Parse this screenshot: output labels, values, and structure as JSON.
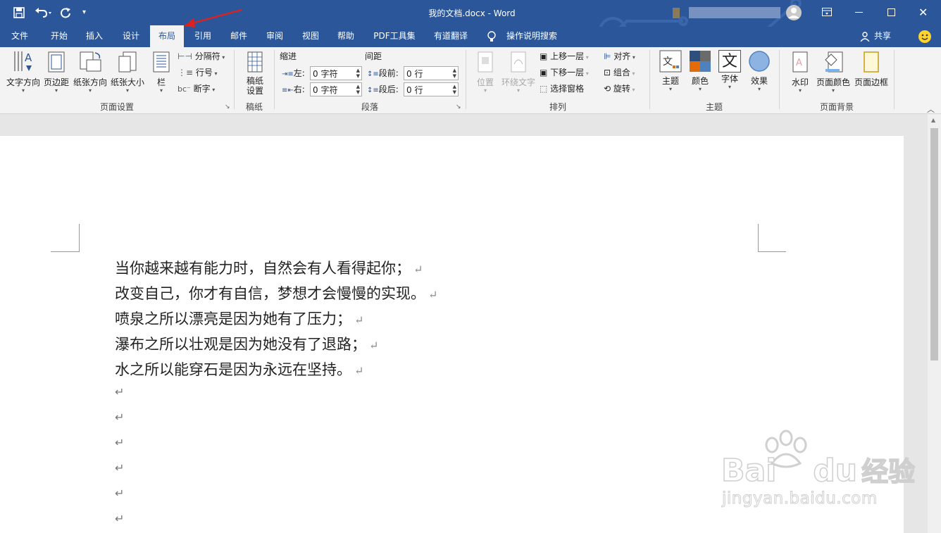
{
  "window": {
    "title": "我的文档.docx - Word",
    "share_label": "共享",
    "quick_access": [
      "save-icon",
      "undo-icon",
      "redo-icon",
      "customize-icon"
    ]
  },
  "tabs": [
    {
      "label": "文件"
    },
    {
      "label": "开始"
    },
    {
      "label": "插入"
    },
    {
      "label": "设计"
    },
    {
      "label": "布局"
    },
    {
      "label": "引用"
    },
    {
      "label": "邮件"
    },
    {
      "label": "审阅"
    },
    {
      "label": "视图"
    },
    {
      "label": "帮助"
    },
    {
      "label": "PDF工具集"
    },
    {
      "label": "有道翻译"
    }
  ],
  "tell_me": "操作说明搜索",
  "ribbon": {
    "page_setup": {
      "label": "页面设置",
      "text_direction": "文字方向",
      "margins": "页边距",
      "orientation": "纸张方向",
      "size": "纸张大小",
      "columns": "栏",
      "breaks": "分隔符",
      "line_numbers": "行号",
      "hyphenation": "断字"
    },
    "manuscript": {
      "label": "稿纸",
      "settings": "稿纸设置"
    },
    "paragraph": {
      "label": "段落",
      "indent_title": "缩进",
      "spacing_title": "间距",
      "left_label": "左:",
      "right_label": "右:",
      "left_value": "0 字符",
      "right_value": "0 字符",
      "before_label": "段前:",
      "after_label": "段后:",
      "before_value": "0 行",
      "after_value": "0 行"
    },
    "arrange": {
      "label": "排列",
      "position": "位置",
      "wrap_text": "环绕文字",
      "bring_forward": "上移一层",
      "send_backward": "下移一层",
      "selection_pane": "选择窗格",
      "align": "对齐",
      "group": "组合",
      "rotate": "旋转"
    },
    "theme": {
      "label": "主题",
      "themes": "主题",
      "colors": "颜色",
      "fonts": "字体",
      "effects": "效果",
      "font_glyph": "文"
    },
    "page_background": {
      "label": "页面背景",
      "watermark": "水印",
      "page_color": "页面颜色",
      "page_borders": "页面边框"
    }
  },
  "document": {
    "lines": [
      "当你越来越有能力时，自然会有人看得起你；",
      "改变自己，你才有自信，梦想才会慢慢的实现。",
      "喷泉之所以漂亮是因为她有了压力；",
      "瀑布之所以壮观是因为她没有了退路；",
      "水之所以能穿石是因为永远在坚持。"
    ],
    "paragraph_mark": "↵"
  },
  "watermark": {
    "brand": "Bai",
    "brand_tail": "du",
    "brand_cn": "经验",
    "url": "jingyan.baidu.com"
  },
  "colors": {
    "accent": "#2b579a",
    "annotation_arrow": "#e02020"
  }
}
